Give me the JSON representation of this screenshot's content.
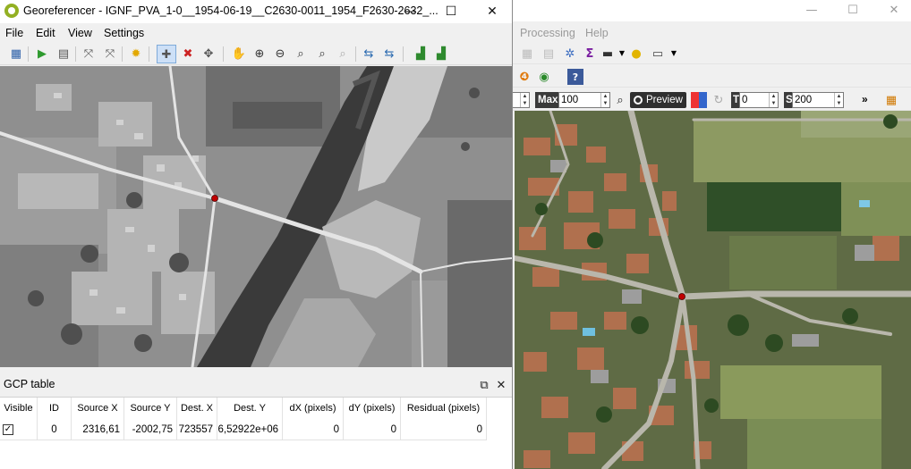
{
  "georeferencer": {
    "title": "Georeferencer - IGNF_PVA_1-0__1954-06-19__C2630-0011_1954_F2630-2632_...",
    "menu": [
      "File",
      "Edit",
      "View",
      "Settings"
    ],
    "toolbar_icons": [
      "open-raster-icon",
      "start-georeferencing-icon",
      "generate-gdal-script-icon",
      "load-gcp-points-icon",
      "save-gcp-points-icon",
      "transformation-settings-icon",
      "add-point-icon",
      "delete-point-icon",
      "move-gcp-point-icon",
      "pan-icon",
      "zoom-in-icon",
      "zoom-out-icon",
      "zoom-to-layer-icon",
      "zoom-last-icon",
      "zoom-next-icon",
      "link-georeferencer-to-qgis-icon",
      "link-qgis-to-georeferencer-icon",
      "full-histogram-stretch-icon",
      "local-histogram-stretch-icon"
    ],
    "window_controls": {
      "minimize": "—",
      "maximize": "☐",
      "close": "✕"
    }
  },
  "gcp_panel": {
    "title": "GCP table",
    "columns": [
      "Visible",
      "ID",
      "Source X",
      "Source Y",
      "Dest. X",
      "Dest. Y",
      "dX (pixels)",
      "dY (pixels)",
      "Residual (pixels)"
    ],
    "rows": [
      {
        "visible": "✓",
        "id": "0",
        "source_x": "2316,61",
        "source_y": "-2002,75",
        "dest_x": "723557",
        "dest_y": "6,52922e+06",
        "dx": "0",
        "dy": "0",
        "residual": "0"
      }
    ]
  },
  "qgis_main": {
    "menu": [
      "Processing",
      "Help"
    ],
    "window_controls": {
      "minimize": "—",
      "maximize": "☐",
      "close": "✕"
    },
    "render_toolbar": {
      "max_label": "Max",
      "max_value": "100",
      "preview_label": "Preview",
      "t_label": "T",
      "t_value": "0",
      "s_label": "S",
      "s_value": "200",
      "more": "»"
    }
  },
  "colors": {
    "gcp_point": "#c00000",
    "qgis_green": "#93b023",
    "active_tool_bg": "#cde0f7"
  }
}
